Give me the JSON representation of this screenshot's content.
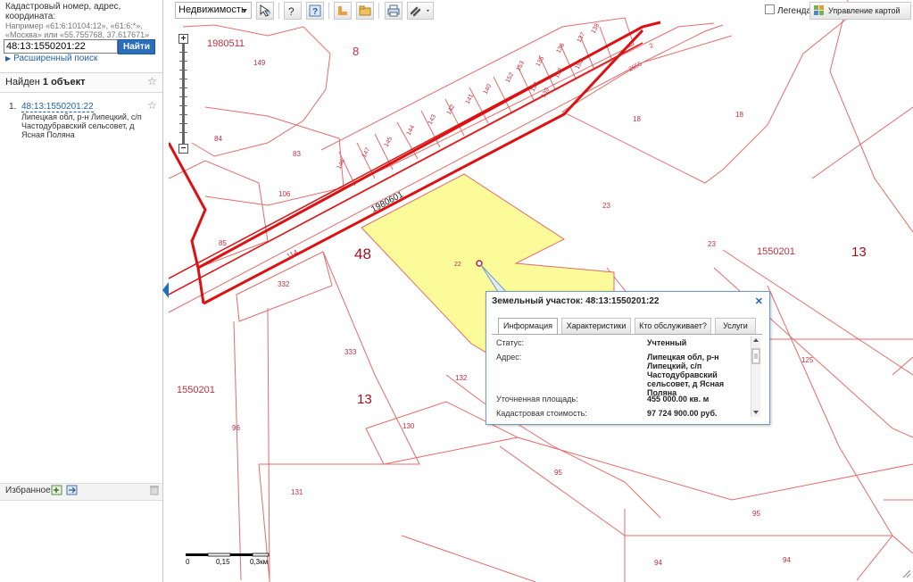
{
  "search": {
    "label": "Кадастровый номер, адрес, координата:",
    "hint": "Например «61:6:10104:12», «61:6:*», «Москва» или «55.755768, 37.617671»",
    "value": "48:13:1550201:22",
    "button": "Найти",
    "advanced_link": "Расширенный поиск"
  },
  "results": {
    "found_prefix": "Найден",
    "found_count": "1 объект",
    "items": [
      {
        "number": "1.",
        "cadastral": "48:13:1550201:22",
        "address": "Липецкая обл, р-н Липецкий, с/п Частодубравский сельсовет, д Ясная Поляна"
      }
    ]
  },
  "favorites": {
    "label": "Избранное"
  },
  "toolbar": {
    "layer": "Недвижимость",
    "legend": "Легенда",
    "manage": "Управление картой"
  },
  "map": {
    "labels": {
      "l1980511": "1980511",
      "l8": "8",
      "l149": "149",
      "l84": "84",
      "l83": "83",
      "l106": "106",
      "l85": "85",
      "l114": "114",
      "l1980601": "1980601",
      "l48": "48",
      "l22": "22",
      "l332": "332",
      "l333": "333",
      "l13a": "13",
      "l1550201a": "1550201",
      "l96": "96",
      "l130": "130",
      "l132": "132",
      "l131": "131",
      "l95a": "95",
      "l95b": "95",
      "l94a": "94",
      "l94b": "94",
      "l18a": "18",
      "l18b": "18",
      "l23a": "23",
      "l23b": "23",
      "l1550201b": "1550201",
      "l13b": "13",
      "l125": "125",
      "l2": "2",
      "l2655": "2655",
      "l146": "146",
      "l147": "147",
      "l145": "145",
      "l144": "144",
      "l143": "143",
      "l142": "142",
      "l141": "141",
      "l140": "140",
      "l152a": "152",
      "l153": "153",
      "l151": "151",
      "l135": "135",
      "l139": "139",
      "l133": "133",
      "l136": "136",
      "l152b": "152",
      "l137": "137",
      "l138": "138"
    },
    "scale": {
      "zero": "0",
      "mid": "0,15",
      "end": "0,3км"
    }
  },
  "popup": {
    "title": "Земельный участок: 48:13:1550201:22",
    "tabs": [
      "Информация",
      "Характеристики",
      "Кто обслуживает?",
      "Услуги"
    ],
    "rows": [
      {
        "label": "Статус:",
        "value": "Учтенный"
      },
      {
        "label": "Адрес:",
        "value": "Липецкая обл, р-н Липецкий, с/п Частодубравский сельсовет, д Ясная Поляна"
      },
      {
        "label": "Уточненная площадь:",
        "value": "455 000.00 кв. м"
      },
      {
        "label": "Кадастровая стоимость:",
        "value": "97 724 900.00 руб."
      }
    ]
  },
  "colors": {
    "parcel_line": "#e06a6a",
    "boundary": "#e01010",
    "selected_fill": "#fbfb9a",
    "accent": "#2a6dbb"
  }
}
